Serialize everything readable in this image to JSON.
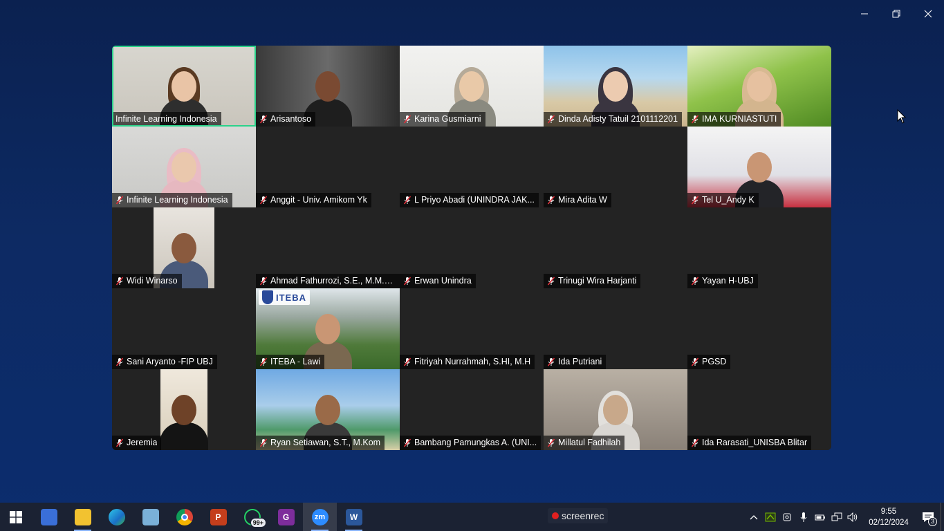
{
  "window": {
    "controls": [
      "minimize",
      "restore",
      "close"
    ]
  },
  "gallery": {
    "tiles": [
      {
        "name": "Infinite Learning Indonesia",
        "muted": false,
        "active": true,
        "video": "woman-hair"
      },
      {
        "name": "Arisantoso",
        "muted": true,
        "video": "man-dark"
      },
      {
        "name": "Karina Gusmiarni",
        "muted": true,
        "video": "woman-hijab-grey"
      },
      {
        "name": "Dinda Adisty Tatuil 2101112201",
        "muted": true,
        "video": "woman-hijab-beach"
      },
      {
        "name": "IMA KURNIASTUTI",
        "muted": true,
        "video": "woman-hijab-grass"
      },
      {
        "name": "Infinite Learning Indonesia",
        "muted": true,
        "video": "woman-hijab-pink"
      },
      {
        "name": "Anggit - Univ. Amikom Yk",
        "muted": true,
        "video": ""
      },
      {
        "name": "L Priyo Abadi (UNINDRA JAK...",
        "muted": true,
        "video": ""
      },
      {
        "name": "Mira Adita W",
        "muted": true,
        "video": ""
      },
      {
        "name": "Tel U_Andy K",
        "muted": true,
        "video": "man-glasses"
      },
      {
        "name": "Widi Winarso",
        "muted": true,
        "video": "man-narrow"
      },
      {
        "name": "Ahmad Fathurrozi, S.E., M.M.S...",
        "muted": true,
        "video": ""
      },
      {
        "name": "Erwan Unindra",
        "muted": true,
        "video": ""
      },
      {
        "name": "Trinugi Wira Harjanti",
        "muted": true,
        "video": ""
      },
      {
        "name": "Yayan H-UBJ",
        "muted": true,
        "video": ""
      },
      {
        "name": "Sani Aryanto -FIP UBJ",
        "muted": true,
        "video": ""
      },
      {
        "name": "ITEBA - Lawi",
        "muted": true,
        "video": "man-iteba",
        "logo_text": "ITEBA"
      },
      {
        "name": "Fitriyah Nurrahmah, S.HI, M.H",
        "muted": true,
        "video": ""
      },
      {
        "name": "Ida Putriani",
        "muted": true,
        "video": ""
      },
      {
        "name": "PGSD",
        "muted": true,
        "video": ""
      },
      {
        "name": "Jeremia",
        "muted": true,
        "video": "man-narrow-2"
      },
      {
        "name": "Ryan Setiawan, S.T., M.Kom",
        "muted": true,
        "video": "man-beach"
      },
      {
        "name": "Bambang Pamungkas A. (UNI...",
        "muted": true,
        "video": ""
      },
      {
        "name": "Millatul Fadhilah",
        "muted": true,
        "video": "woman-hijab-white"
      },
      {
        "name": "Ida Rarasati_UNISBA Blitar",
        "muted": true,
        "video": ""
      }
    ]
  },
  "taskbar": {
    "apps": [
      {
        "name": "calculator-icon",
        "color": "#3a6fd8",
        "glyph": ""
      },
      {
        "name": "file-explorer-icon",
        "color": "#f2c230",
        "glyph": ""
      },
      {
        "name": "edge-icon",
        "color": "#1fa0c8",
        "glyph": ""
      },
      {
        "name": "notepad-icon",
        "color": "#7ab0d8",
        "glyph": ""
      },
      {
        "name": "chrome-icon",
        "color": "#db4437",
        "glyph": ""
      },
      {
        "name": "powerpoint-icon",
        "color": "#c43e1c",
        "glyph": "P"
      },
      {
        "name": "whatsapp-icon",
        "color": "#25d366",
        "glyph": "",
        "badge": "99+"
      },
      {
        "name": "pdf-app-icon",
        "color": "#7d2d9b",
        "glyph": "G"
      },
      {
        "name": "zoom-icon",
        "color": "#2d8cff",
        "glyph": "zm",
        "active": true
      },
      {
        "name": "word-icon",
        "color": "#2b579a",
        "glyph": "W"
      }
    ],
    "screenrec_label": "screenrec",
    "clock_time": "9:55",
    "clock_date": "02/12/2024",
    "notification_count": "3"
  }
}
